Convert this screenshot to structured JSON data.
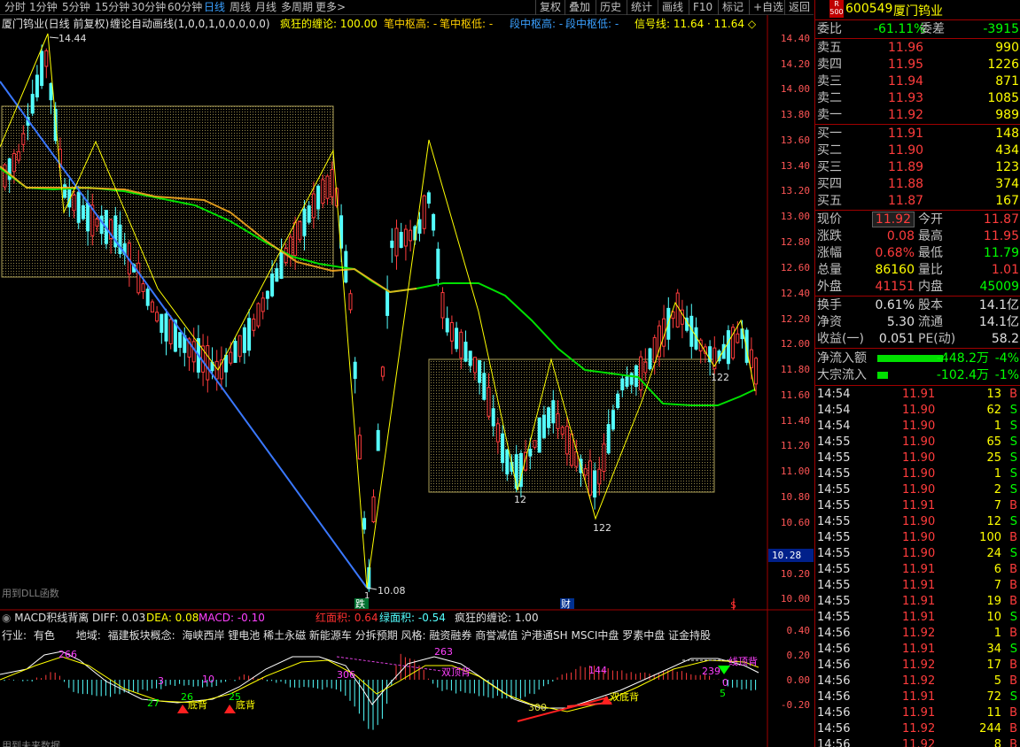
{
  "toolbar": {
    "periods": [
      "分时",
      "1分钟",
      "5分钟",
      "15分钟",
      "30分钟",
      "60分钟",
      "日线",
      "周线",
      "月线",
      "多周期",
      "更多>"
    ],
    "active_period": "日线",
    "right_buttons": [
      "复权",
      "叠加",
      "历史",
      "统计",
      "画线",
      "F10",
      "标记",
      "+自选",
      "返回"
    ]
  },
  "legend": {
    "stock": "厦门钨业(日线 前复权)",
    "indicator": "缠论自动画线(1,0,0,1,0,0,0,0,0)",
    "crazy": "疯狂的缠论: 100.00",
    "bi_high": "笔中枢高: -",
    "bi_low": "笔中枢低: -",
    "duan_high": "段中枢高: -",
    "duan_low": "段中枢低: -",
    "signal": "信号线: 11.64 · 11.64 ◇"
  },
  "main_chart": {
    "y_ticks": [
      "14.40",
      "14.20",
      "14.00",
      "13.80",
      "13.60",
      "13.40",
      "13.20",
      "13.00",
      "12.80",
      "12.60",
      "12.40",
      "12.20",
      "12.00",
      "11.80",
      "11.60",
      "11.40",
      "11.20",
      "11.00",
      "10.80",
      "10.60",
      "10.40",
      "10.20",
      "10.00"
    ],
    "current_price_tag": "10.28",
    "high_label": "14.44",
    "low_label": "10.08",
    "labels": [
      "12",
      "122",
      "122",
      "1"
    ],
    "dll_note": "用到DLL函数",
    "markers": [
      "跌",
      "财",
      "$"
    ]
  },
  "macd": {
    "title": "MACD积线背离",
    "diff": "DIFF: 0.03",
    "dea": "DEA: 0.08",
    "macd": "MACD: -0.10",
    "red_area": "红面积: 0.64",
    "green_area": "绿面积: -0.54",
    "crazy": "疯狂的缠论: 1.00",
    "industry_label": "行业:",
    "industry_value": "有色",
    "region_label": "地域:",
    "region_value": "福建板块概念:",
    "concepts": "海峡西岸 锂电池 稀土永磁 新能源车 分拆预期 风格: 融资融券 商誉减值 沪港通SH MSCI中盘 罗素中盘 证金持股",
    "y_ticks": [
      "0.40",
      "0.20",
      "0.00",
      "-0.20"
    ],
    "annotations": [
      "266",
      "263",
      "306",
      "300",
      "144",
      "239",
      "26",
      "25",
      "27",
      "10",
      "3",
      "0",
      "5"
    ],
    "signals": [
      "底背",
      "底背",
      "双顶背",
      "双底背",
      "线顶背"
    ],
    "future_note": "用到未来数据"
  },
  "quote": {
    "market_tag": "R\n500",
    "code": "600549",
    "name": "厦门钨业",
    "weibi_label": "委比",
    "weibi_value": "-61.11%",
    "weicha_label": "委差",
    "weicha_value": "-3915",
    "asks": [
      {
        "label": "卖五",
        "price": "11.96",
        "vol": "990"
      },
      {
        "label": "卖四",
        "price": "11.95",
        "vol": "1226"
      },
      {
        "label": "卖三",
        "price": "11.94",
        "vol": "871"
      },
      {
        "label": "卖二",
        "price": "11.93",
        "vol": "1085"
      },
      {
        "label": "卖一",
        "price": "11.92",
        "vol": "989"
      }
    ],
    "bids": [
      {
        "label": "买一",
        "price": "11.91",
        "vol": "148"
      },
      {
        "label": "买二",
        "price": "11.90",
        "vol": "434"
      },
      {
        "label": "买三",
        "price": "11.89",
        "vol": "123"
      },
      {
        "label": "买四",
        "price": "11.88",
        "vol": "374"
      },
      {
        "label": "买五",
        "price": "11.87",
        "vol": "167"
      }
    ],
    "stats": [
      {
        "l1": "现价",
        "v1": "11.92",
        "l2": "今开",
        "v2": "11.87"
      },
      {
        "l1": "涨跌",
        "v1": "0.08",
        "l2": "最高",
        "v2": "11.95"
      },
      {
        "l1": "涨幅",
        "v1": "0.68%",
        "l2": "最低",
        "v2": "11.79"
      },
      {
        "l1": "总量",
        "v1": "86160",
        "l2": "量比",
        "v2": "1.01"
      },
      {
        "l1": "外盘",
        "v1": "41151",
        "l2": "内盘",
        "v2": "45009"
      }
    ],
    "stats2": [
      {
        "l1": "换手",
        "v1": "0.61%",
        "l2": "股本",
        "v2": "14.1亿"
      },
      {
        "l1": "净资",
        "v1": "5.30",
        "l2": "流通",
        "v2": "14.1亿"
      },
      {
        "l1": "收益(一)",
        "v1": "0.051",
        "l2": "PE(动)",
        "v2": "58.2"
      }
    ],
    "flow": [
      {
        "label": "净流入额",
        "value": "-448.2万",
        "pct": "-4%"
      },
      {
        "label": "大宗流入",
        "value": "-102.4万",
        "pct": "-1%"
      }
    ]
  },
  "ticks": [
    {
      "t": "14:54",
      "p": "11.91",
      "v": "13",
      "s": "B"
    },
    {
      "t": "14:54",
      "p": "11.90",
      "v": "62",
      "s": "S"
    },
    {
      "t": "14:54",
      "p": "11.90",
      "v": "1",
      "s": "S"
    },
    {
      "t": "14:55",
      "p": "11.90",
      "v": "65",
      "s": "S"
    },
    {
      "t": "14:55",
      "p": "11.90",
      "v": "25",
      "s": "S"
    },
    {
      "t": "14:55",
      "p": "11.90",
      "v": "1",
      "s": "S"
    },
    {
      "t": "14:55",
      "p": "11.90",
      "v": "2",
      "s": "S"
    },
    {
      "t": "14:55",
      "p": "11.91",
      "v": "7",
      "s": "B"
    },
    {
      "t": "14:55",
      "p": "11.90",
      "v": "12",
      "s": "S"
    },
    {
      "t": "14:55",
      "p": "11.90",
      "v": "100",
      "s": "B"
    },
    {
      "t": "14:55",
      "p": "11.90",
      "v": "24",
      "s": "S"
    },
    {
      "t": "14:55",
      "p": "11.91",
      "v": "6",
      "s": "B"
    },
    {
      "t": "14:55",
      "p": "11.91",
      "v": "7",
      "s": "B"
    },
    {
      "t": "14:55",
      "p": "11.91",
      "v": "19",
      "s": "B"
    },
    {
      "t": "14:55",
      "p": "11.91",
      "v": "10",
      "s": "S"
    },
    {
      "t": "14:56",
      "p": "11.92",
      "v": "1",
      "s": "B"
    },
    {
      "t": "14:56",
      "p": "11.91",
      "v": "34",
      "s": "S"
    },
    {
      "t": "14:56",
      "p": "11.92",
      "v": "17",
      "s": "B"
    },
    {
      "t": "14:56",
      "p": "11.92",
      "v": "5",
      "s": "B"
    },
    {
      "t": "14:56",
      "p": "11.91",
      "v": "72",
      "s": "S"
    },
    {
      "t": "14:56",
      "p": "11.91",
      "v": "11",
      "s": "B"
    },
    {
      "t": "14:56",
      "p": "11.92",
      "v": "244",
      "s": "B"
    },
    {
      "t": "14:56",
      "p": "11.92",
      "v": "8",
      "s": "B"
    }
  ],
  "colors": {
    "up": "#ff3c3c",
    "down": "#54ffff",
    "yellow": "#ffff00",
    "green": "#00e000",
    "blue": "#3a78ff",
    "bg": "#000000"
  }
}
